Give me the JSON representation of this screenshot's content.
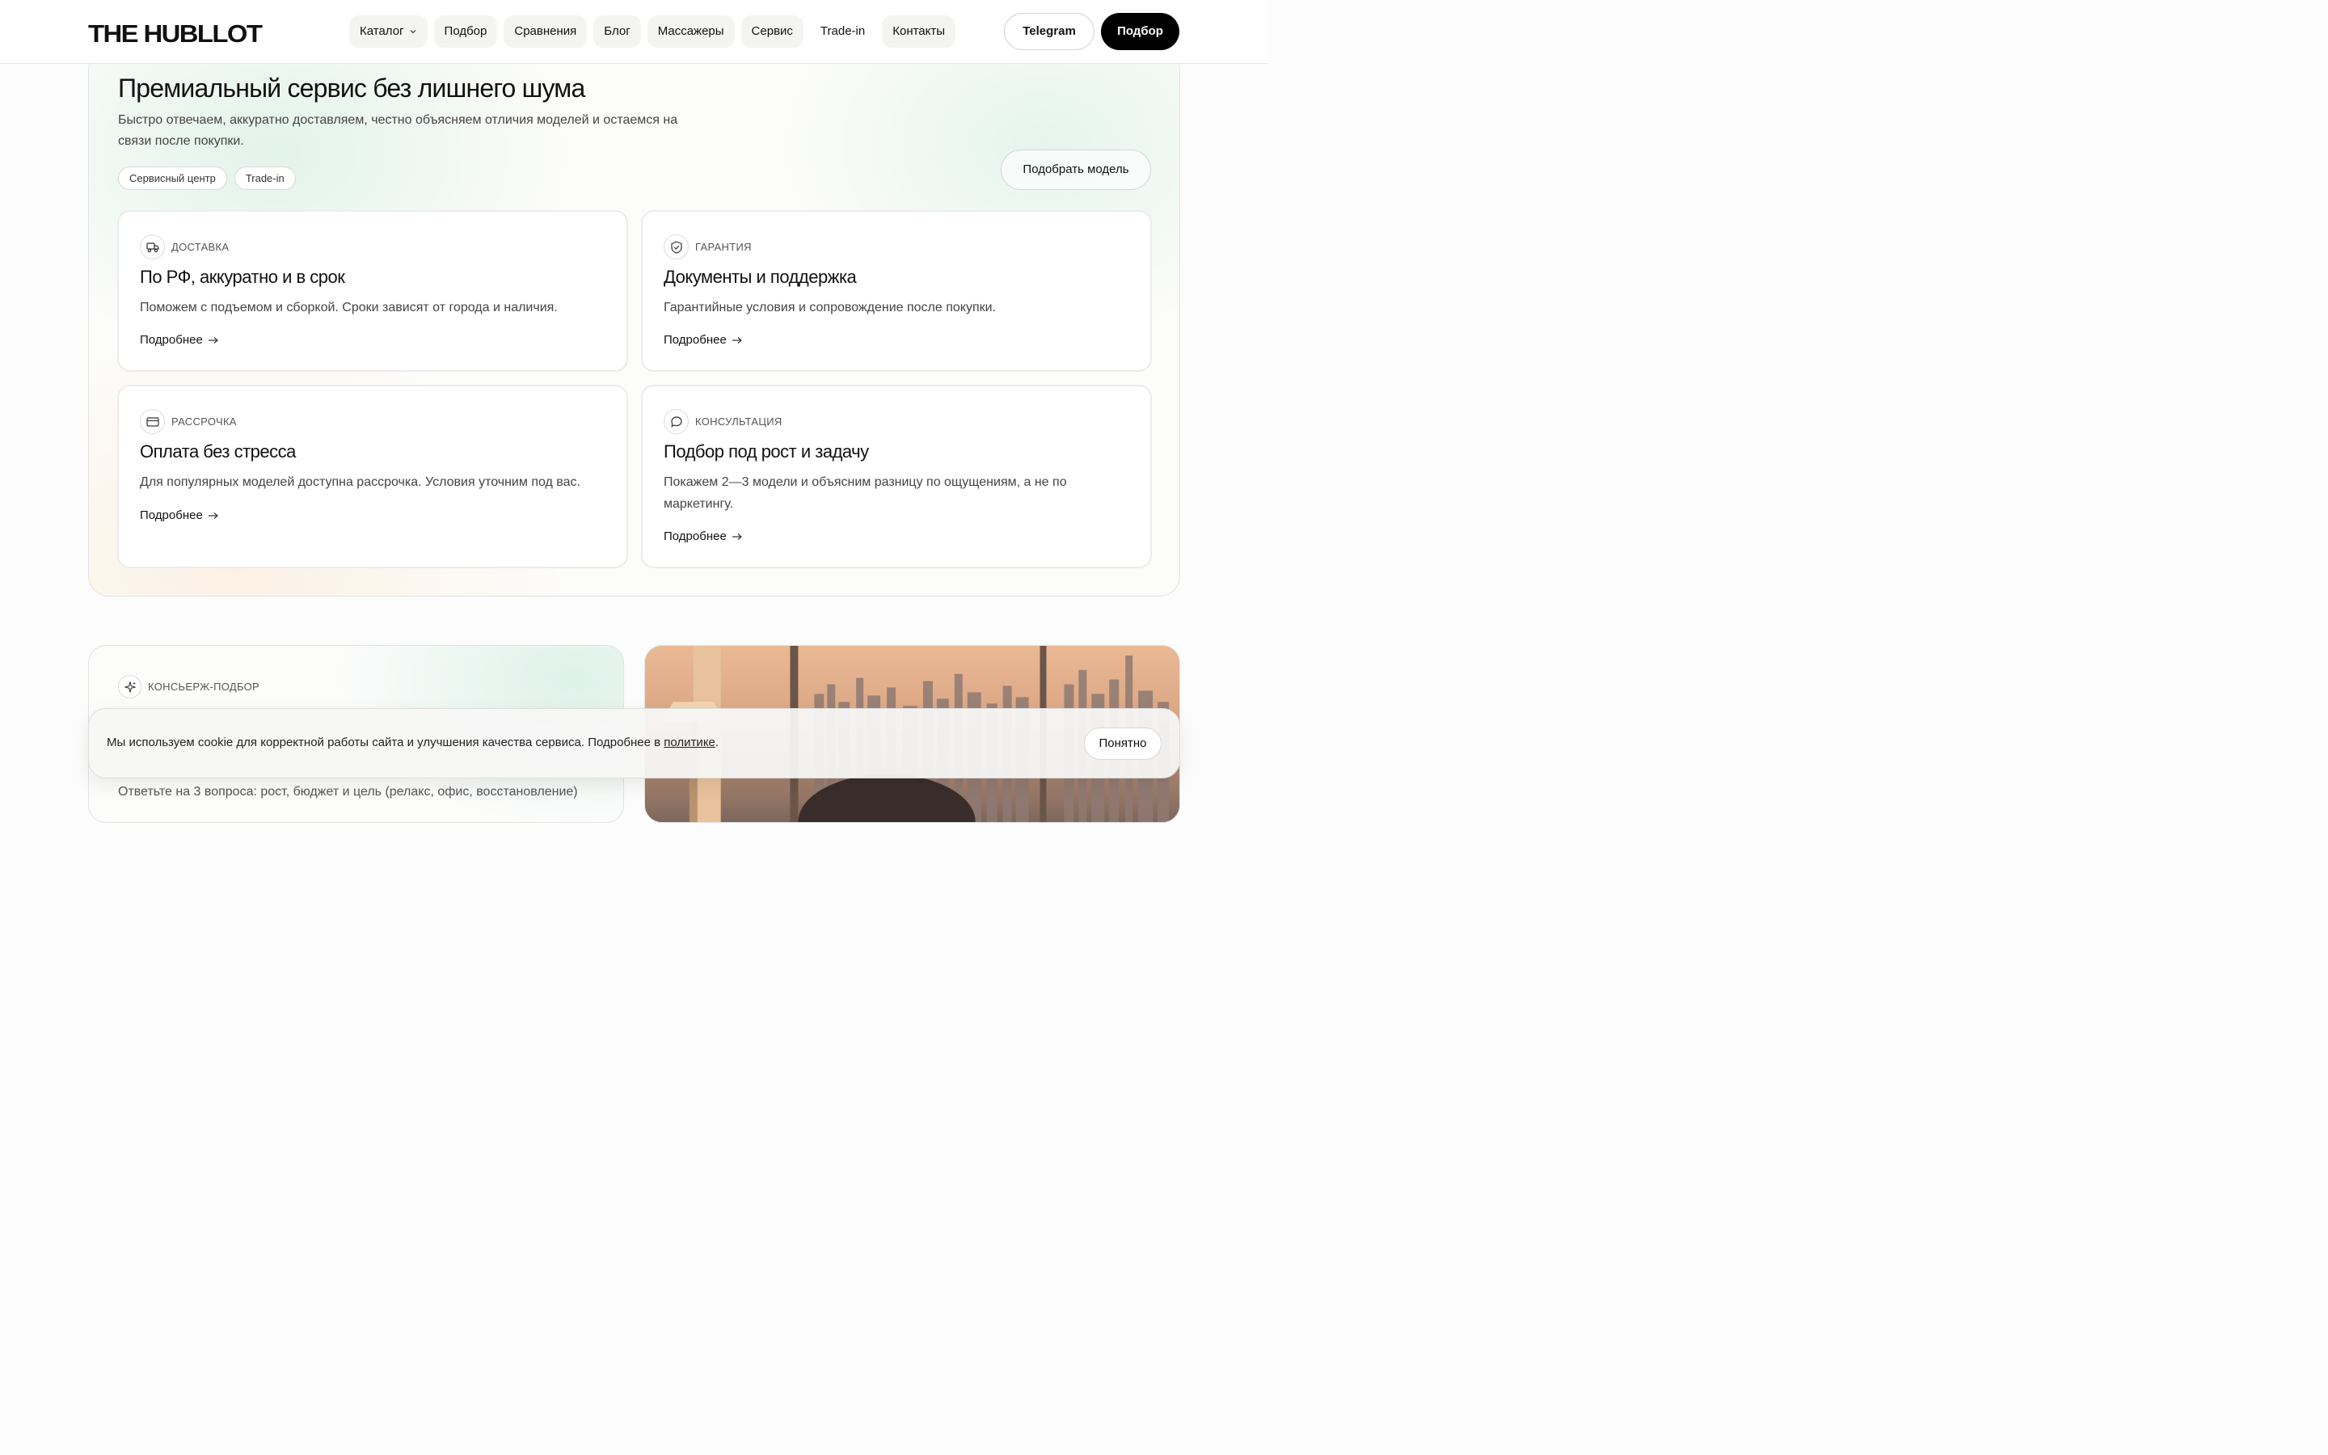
{
  "header": {
    "logo": "THE HUBLLOT",
    "nav": [
      {
        "label": "Каталог",
        "has_dropdown": true,
        "pill": true
      },
      {
        "label": "Подбор",
        "pill": true
      },
      {
        "label": "Сравнения",
        "pill": true
      },
      {
        "label": "Блог",
        "pill": true
      },
      {
        "label": "Массажеры",
        "pill": true
      },
      {
        "label": "Сервис",
        "pill": true
      },
      {
        "label": "Trade-in",
        "pill": false
      },
      {
        "label": "Контакты",
        "pill": true
      }
    ],
    "telegram_label": "Telegram",
    "cta_label": "Подбор"
  },
  "service": {
    "title": "Премиальный сервис без лишнего шума",
    "subtitle": "Быстро отвечаем, аккуратно доставляем, честно объясняем отличия моделей и остаемся на связи после покупки.",
    "chips": [
      "Сервисный центр",
      "Trade-in"
    ],
    "pick_button": "Подобрать модель",
    "cards": [
      {
        "icon": "truck-icon",
        "tag": "ДОСТАВКА",
        "title": "По РФ, аккуратно и в срок",
        "text": "Поможем с подъемом и сборкой. Сроки зависят от города и наличия.",
        "link": "Подробнее"
      },
      {
        "icon": "shield-check-icon",
        "tag": "ГАРАНТИЯ",
        "title": "Документы и поддержка",
        "text": "Гарантийные условия и сопровождение после покупки.",
        "link": "Подробнее"
      },
      {
        "icon": "credit-card-icon",
        "tag": "РАССРОЧКА",
        "title": "Оплата без стресса",
        "text": "Для популярных моделей доступна рассрочка. Условия уточним под вас.",
        "link": "Подробнее"
      },
      {
        "icon": "chat-bubble-icon",
        "tag": "КОНСУЛЬТАЦИЯ",
        "title": "Подбор под рост и задачу",
        "text": "Покажем 2—3 модели и объясним разницу по ощущениям, а не по маркетингу.",
        "link": "Подробнее"
      }
    ]
  },
  "concierge": {
    "icon": "sparkle-icon",
    "tag": "КОНСЬЕРЖ-ПОДБОР",
    "hint": "Ответьте на 3 вопроса: рост, бюджет и цель (релакс, офис, восстановление)"
  },
  "cookie": {
    "text_before": "Мы используем cookie для корректной работы сайта и улучшения качества сервиса. Подробнее в ",
    "link": "политике",
    "text_after": ".",
    "button": "Понятно"
  },
  "colors": {
    "accent": "#000000",
    "mint": "#d3ede3",
    "peach": "#fde8d2"
  }
}
